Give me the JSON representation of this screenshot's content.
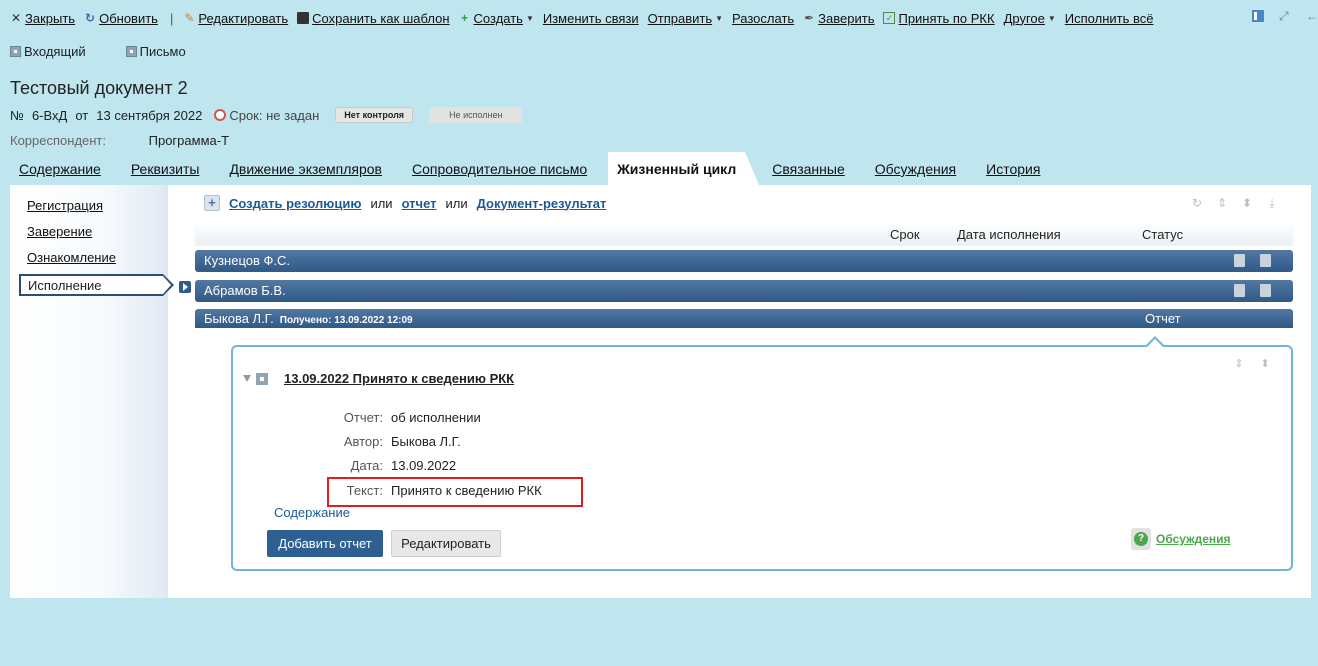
{
  "toolbar": {
    "items": [
      {
        "label": "Закрыть",
        "icon": "close-icon",
        "dropdown": false
      },
      {
        "label": "Обновить",
        "icon": "refresh-icon",
        "dropdown": false
      },
      {
        "label": "Редактировать",
        "icon": "pencil-icon",
        "dropdown": false
      },
      {
        "label": "Сохранить как шаблон",
        "icon": "save-icon",
        "dropdown": false
      },
      {
        "label": "Создать",
        "icon": "plus-icon",
        "dropdown": true
      },
      {
        "label": "Изменить связи",
        "icon": "",
        "dropdown": false
      },
      {
        "label": "Отправить",
        "icon": "",
        "dropdown": true
      },
      {
        "label": "Разослать",
        "icon": "",
        "dropdown": false
      },
      {
        "label": "Заверить",
        "icon": "pen-icon",
        "dropdown": false
      },
      {
        "label": "Принять по РКК",
        "icon": "checkbox-icon",
        "dropdown": false
      },
      {
        "label": "Другое",
        "icon": "",
        "dropdown": true
      },
      {
        "label": "Исполнить всё",
        "icon": "",
        "dropdown": false
      }
    ]
  },
  "doc": {
    "types": [
      "Входящий",
      "Письмо"
    ],
    "title": "Тестовый документ 2",
    "number_prefix": "№",
    "number": "6-ВхД",
    "date_prefix": "от",
    "date": "13 сентября 2022",
    "deadline": "Срок: не задан",
    "control_badge": "Нет контроля",
    "status_badge": "Не исполнен",
    "correspondent_label": "Корреспондент:",
    "correspondent_value": "Программа-Т"
  },
  "tabs": [
    "Содержание",
    "Реквизиты",
    "Движение экземпляров",
    "Сопроводительное письмо",
    "Жизненный цикл",
    "Связанные",
    "Обсуждения",
    "История"
  ],
  "active_tab": "Жизненный цикл",
  "left_nav": [
    "Регистрация",
    "Заверение",
    "Ознакомление",
    "Исполнение"
  ],
  "actions": {
    "create_resolution": "Создать резолюцию",
    "or1": "или",
    "report": "отчет",
    "or2": "или",
    "doc_result": "Документ-результат"
  },
  "table_headers": {
    "deadline": "Срок",
    "exec_date": "Дата исполнения",
    "status": "Статус"
  },
  "executors": [
    {
      "name": "Кузнецов Ф.С."
    },
    {
      "name": "Абрамов Б.В."
    },
    {
      "name": "Быкова Л.Г.",
      "received": "Получено: 13.09.2022 12:09",
      "status": "Отчет"
    }
  ],
  "report": {
    "title": "13.09.2022 Принято к сведению РКК",
    "fields": [
      {
        "label": "Отчет:",
        "value": "об исполнении"
      },
      {
        "label": "Автор:",
        "value": "Быкова Л.Г."
      },
      {
        "label": "Дата:",
        "value": "13.09.2022"
      },
      {
        "label": "Текст:",
        "value": "Принято к сведению РКК"
      }
    ],
    "content_link": "Содержание",
    "add_button": "Добавить отчет",
    "edit_button": "Редактировать",
    "discussions": "Обсуждения"
  }
}
